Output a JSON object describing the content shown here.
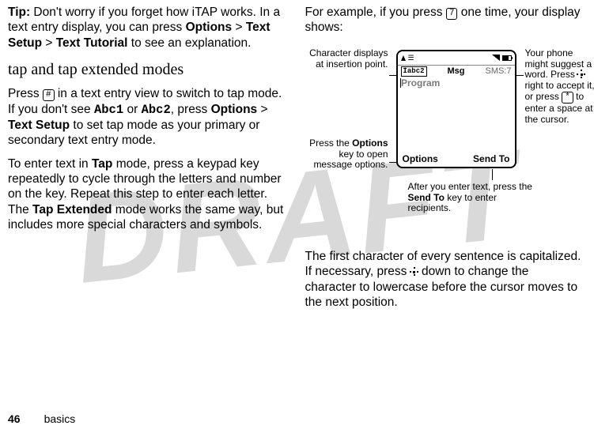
{
  "watermark": "DRAFT",
  "left_col": {
    "tip_label": "Tip:",
    "tip_body_a": " Don't worry if you forget how iTAP works. In a text entry display, you can press ",
    "tip_options": "Options",
    "gt1": " > ",
    "tip_textsetup": "Text Setup",
    "gt2": " > ",
    "tip_tutorial": "Text Tutorial",
    "tip_body_b": " to see an explanation.",
    "subhead": "tap and tap extended modes",
    "p2a": "Press ",
    "p2_key": "#",
    "p2b": " in a text entry view to switch to tap mode. If you don't see ",
    "p2_abc1": "Abc1",
    "p2_or": " or ",
    "p2_abc2": "Abc2",
    "p2c": ", press ",
    "p2_options": "Options",
    "p2_gt": " > ",
    "p2_textsetup": "Text Setup",
    "p2d": " to set tap mode as your primary or secondary text entry mode.",
    "p3a": "To enter text in ",
    "p3_tap": "Tap",
    "p3b": " mode, press a keypad key repeatedly to cycle through the letters and number on the key. Repeat this step to enter each letter. The ",
    "p3_tapext": "Tap Extended",
    "p3c": " mode works the same way, but includes more special characters and symbols."
  },
  "right_col": {
    "p1a": "For example, if you press ",
    "p1_key": "7",
    "p1b": " one time, your display shows:",
    "p2a": "The first character of every sentence is capitalized. If necessary, press ",
    "p2b": " down to change the character to lowercase before the cursor moves to the next position."
  },
  "phone": {
    "abc_mode": "Íabc2",
    "msg_label": "Msg",
    "sms_counter": "SMS:7",
    "typed_word": "Program",
    "soft_left": "Options",
    "soft_right": "Send To"
  },
  "callouts": {
    "insertion": "Character displays at insertion point.",
    "options_a": "Press the ",
    "options_b": "Options",
    "options_c": " key to open message options.",
    "sendto_a": "After you enter text, press the ",
    "sendto_b": "Send To",
    "sendto_c": " key to enter recipients.",
    "suggest_a": "Your phone might suggest a word. Press ",
    "suggest_b": " right to accept it, or press ",
    "suggest_key": "*",
    "suggest_c": " to enter a space at the cursor."
  },
  "footer": {
    "page": "46",
    "section": "basics"
  }
}
